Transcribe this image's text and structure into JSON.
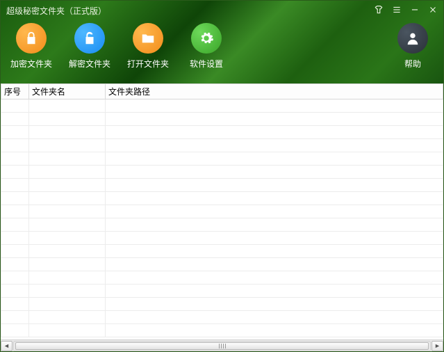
{
  "title": "超级秘密文件夹（正式版）",
  "toolbar": {
    "encrypt": "加密文件夹",
    "decrypt": "解密文件夹",
    "open": "打开文件夹",
    "settings": "软件设置",
    "help": "帮助"
  },
  "columns": {
    "index": "序号",
    "name": "文件夹名",
    "path": "文件夹路径"
  },
  "rows": [
    "",
    "",
    "",
    "",
    "",
    "",
    "",
    "",
    "",
    "",
    "",
    "",
    "",
    "",
    "",
    "",
    "",
    ""
  ]
}
